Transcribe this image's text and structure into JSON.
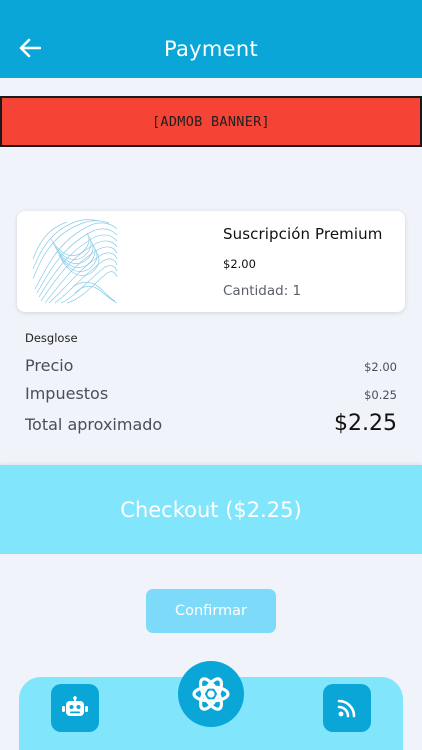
{
  "header": {
    "title": "Payment",
    "back_icon": "arrow-left-icon",
    "color": "#0aa6d8"
  },
  "ad_banner": {
    "label": "[ADMOB BANNER]",
    "color": "#f54336"
  },
  "product": {
    "name": "Suscripción Premium",
    "price": "$2.00",
    "quantity": "Cantidad: 1",
    "image_icon": "wave-lines-image"
  },
  "breakdown": {
    "title": "Desglose",
    "rows": [
      {
        "label": "Precio",
        "value": "$2.00"
      },
      {
        "label": "Impuestos",
        "value": "$0.25"
      }
    ],
    "total_label": "Total aproximado",
    "total_value": "$2.25"
  },
  "checkout": {
    "label": "Checkout ($2.25)",
    "color": "#81e5fb"
  },
  "confirm": {
    "label": "Confirmar"
  },
  "bottom_nav": {
    "items": [
      {
        "icon": "robot-icon"
      },
      {
        "icon": "atom-icon"
      },
      {
        "icon": "rss-icon"
      }
    ]
  }
}
